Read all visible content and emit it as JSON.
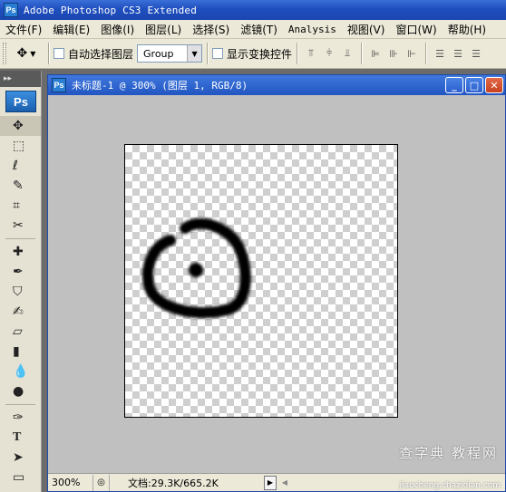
{
  "app": {
    "title": "Adobe Photoshop CS3 Extended",
    "badge": "Ps"
  },
  "menu": [
    "文件(F)",
    "编辑(E)",
    "图像(I)",
    "图层(L)",
    "选择(S)",
    "滤镜(T)",
    "Analysis",
    "视图(V)",
    "窗口(W)",
    "帮助(H)"
  ],
  "options": {
    "auto_select_label": "自动选择图层",
    "auto_select_value": "Group",
    "show_transform_label": "显示变换控件"
  },
  "toolbox": {
    "badge": "Ps"
  },
  "document": {
    "title": "未标题-1 @ 300% (图层 1, RGB/8)",
    "zoom": "300%",
    "doc_info": "文档:29.3K/665.2K"
  },
  "watermark": {
    "cn": "查字典 教程网",
    "url": "jiaocheng.chazidian.com"
  }
}
